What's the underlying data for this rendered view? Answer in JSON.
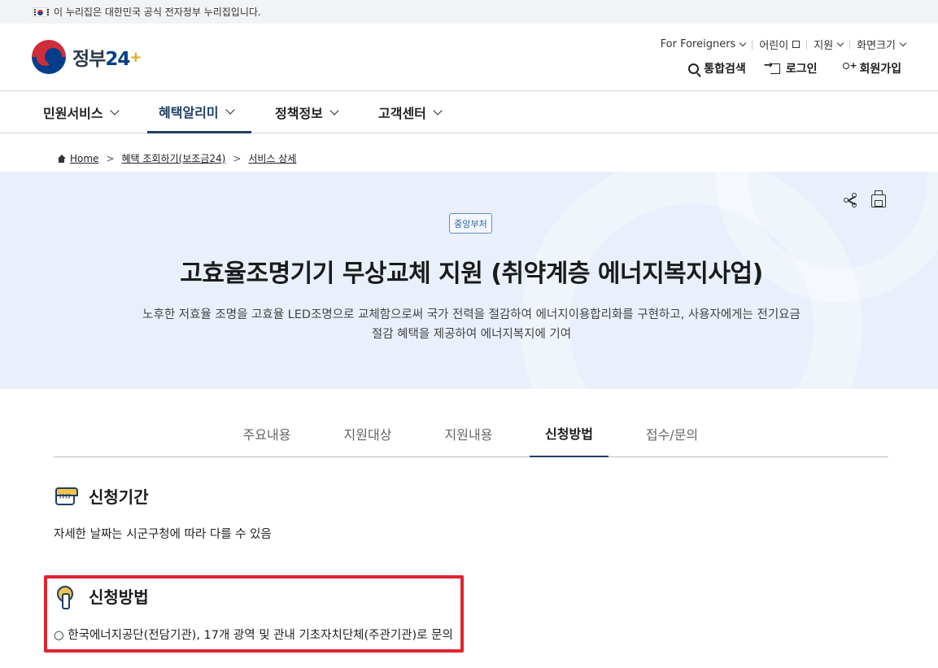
{
  "notice": {
    "text": "이 누리집은 대한민국 공식 전자정부 누리집입니다."
  },
  "logo": {
    "text": "정부",
    "num": "24",
    "plus": "+"
  },
  "util_links": [
    "For Foreigners",
    "어린이",
    "지원",
    "화면크기"
  ],
  "actions": {
    "search": "통합검색",
    "login": "로그인",
    "join": "회원가입"
  },
  "nav": [
    {
      "label": "민원서비스"
    },
    {
      "label": "혜택알리미"
    },
    {
      "label": "정책정보"
    },
    {
      "label": "고객센터"
    }
  ],
  "breadcrumb": {
    "home": "Home",
    "level1": "혜택 조회하기(보조금24)",
    "level2": "서비스 상세"
  },
  "hero": {
    "badge": "중앙부처",
    "title": "고효율조명기기 무상교체 지원 (취약계층 에너지복지사업)",
    "desc_line1": "노후한 저효율 조명을 고효율 LED조명으로 교체함으로써 국가 전력을 절감하여 에너지이용합리화를 구현하고, 사용자에게는 전기요금",
    "desc_line2": "절감 혜택을 제공하여 에너지복지에 기여"
  },
  "tabs": [
    "주요내용",
    "지원대상",
    "지원내용",
    "신청방법",
    "접수/문의"
  ],
  "active_tab": "신청방법",
  "sections": {
    "period": {
      "title": "신청기간",
      "text": "자세한 날짜는 시군구청에 따라 다를 수 있음"
    },
    "method": {
      "title": "신청방법",
      "text": "○ 한국에너지공단(전담기관), 17개 광역 및 관내 기초자치단체(주관기관)로 문의"
    }
  },
  "colors": {
    "brand_navy": "#1f3f66",
    "hero_bg": "#e9f0fb",
    "highlight": "#e1232f"
  }
}
